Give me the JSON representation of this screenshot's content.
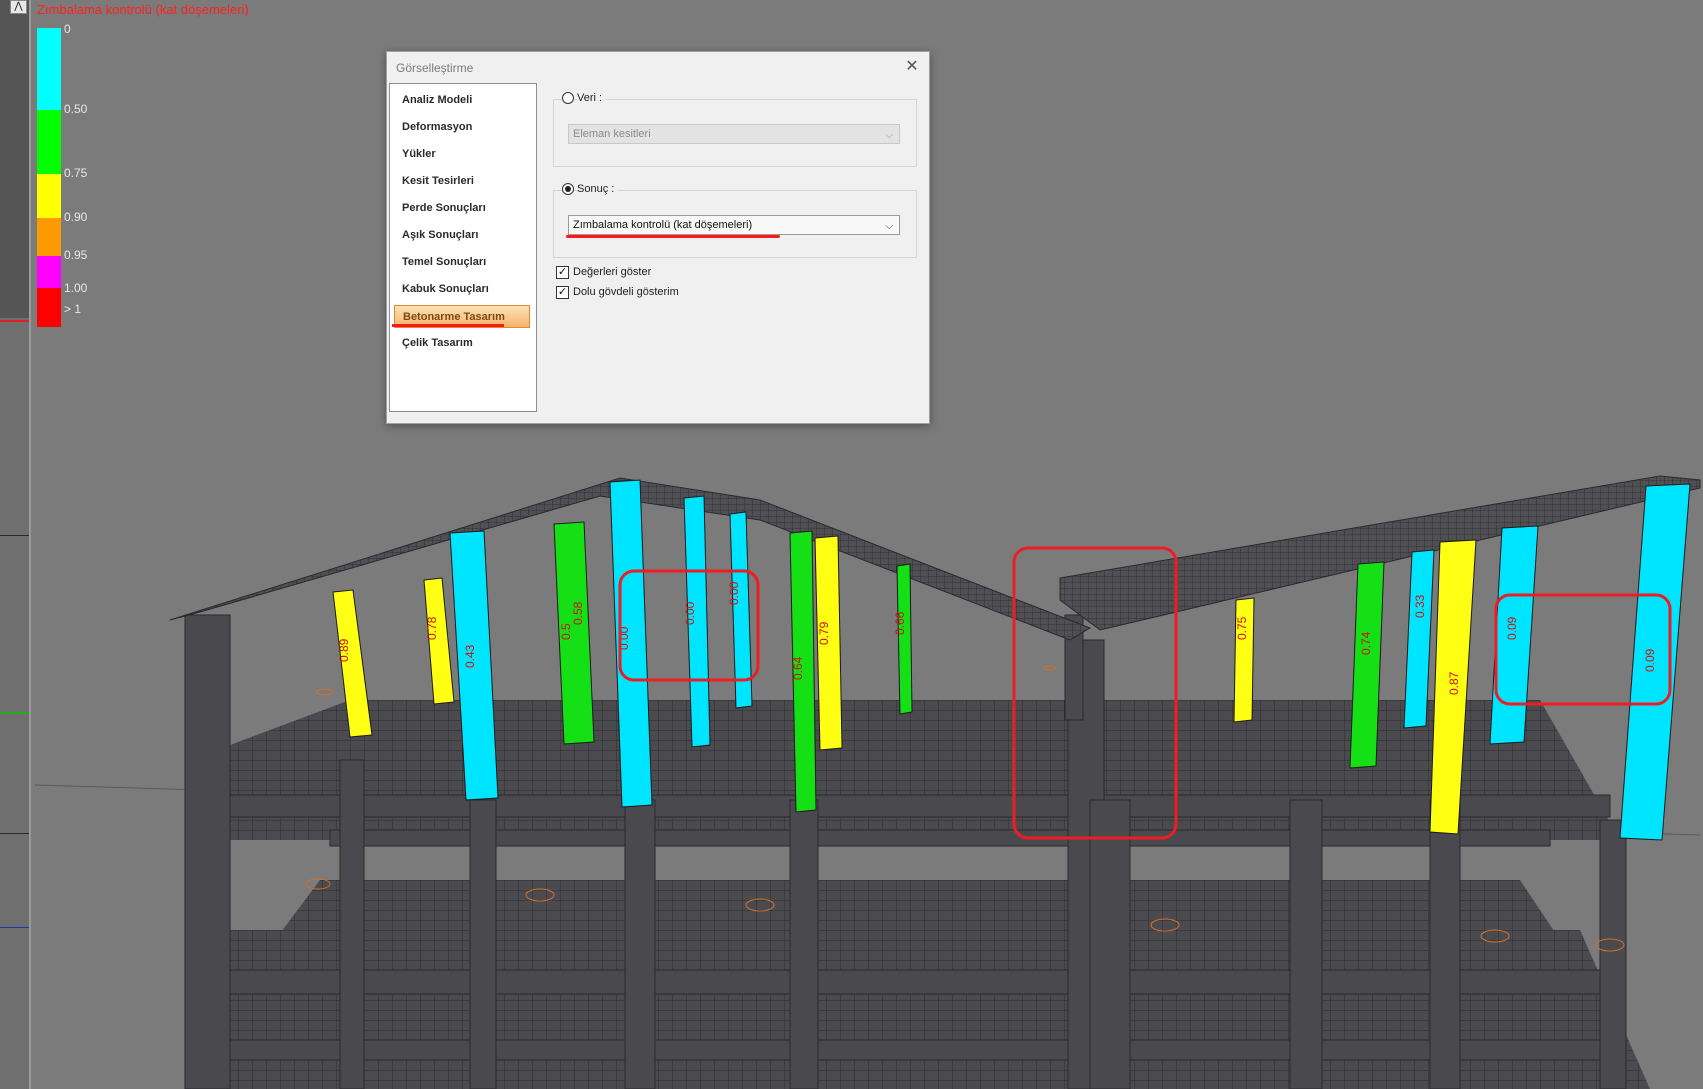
{
  "legend": {
    "title": "Zımbalama kontrolü (kat döşemeleri)",
    "items": [
      {
        "label": "0",
        "color": "#00ffff"
      },
      {
        "label": "0.50",
        "color": "#00ff00"
      },
      {
        "label": "0.75",
        "color": "#ffff00"
      },
      {
        "label": "0.90",
        "color": "#ff9900"
      },
      {
        "label": "0.95",
        "color": "#ff00ff"
      },
      {
        "label": "1.00",
        "color": "#ff0000"
      },
      {
        "label": "> 1",
        "color": ""
      }
    ]
  },
  "dialog": {
    "title": "Görselleştirme",
    "close_glyph": "✕",
    "nav_items": [
      "Analiz Modeli",
      "Deformasyon",
      "Yükler",
      "Kesit Tesirleri",
      "Perde Sonuçları",
      "Aşık Sonuçları",
      "Temel Sonuçları",
      "Kabuk Sonuçları",
      "Betonarme Tasarım",
      "Çelik Tasarım"
    ],
    "active_nav_index": 8,
    "veri": {
      "label": "Veri :",
      "selected": false,
      "combo_value": "Eleman kesitleri",
      "enabled": false
    },
    "sonuc": {
      "label": "Sonuç :",
      "selected": true,
      "combo_value": "Zımbalama kontrolü (kat döşemeleri)"
    },
    "checkboxes": [
      {
        "label": "Değerleri göster",
        "checked": true
      },
      {
        "label": "Dolu gövdeli gösterim",
        "checked": true
      }
    ]
  },
  "model_view": {
    "column_values": [
      "0.89",
      "0.78",
      "0.43",
      "0.5",
      "0.58",
      "0.00",
      "0.00",
      "0.00",
      "0.64",
      "0.79",
      "0.66",
      "0.75",
      "0.74",
      "0.33",
      "0.87",
      "0.09",
      "0.09"
    ],
    "colors": {
      "background": "#7b7b7b",
      "structure": "#4a4a4e",
      "cyan": "#00e5ff",
      "green": "#15e015",
      "yellow": "#ffff14",
      "highlight": "#ee1c25"
    }
  }
}
